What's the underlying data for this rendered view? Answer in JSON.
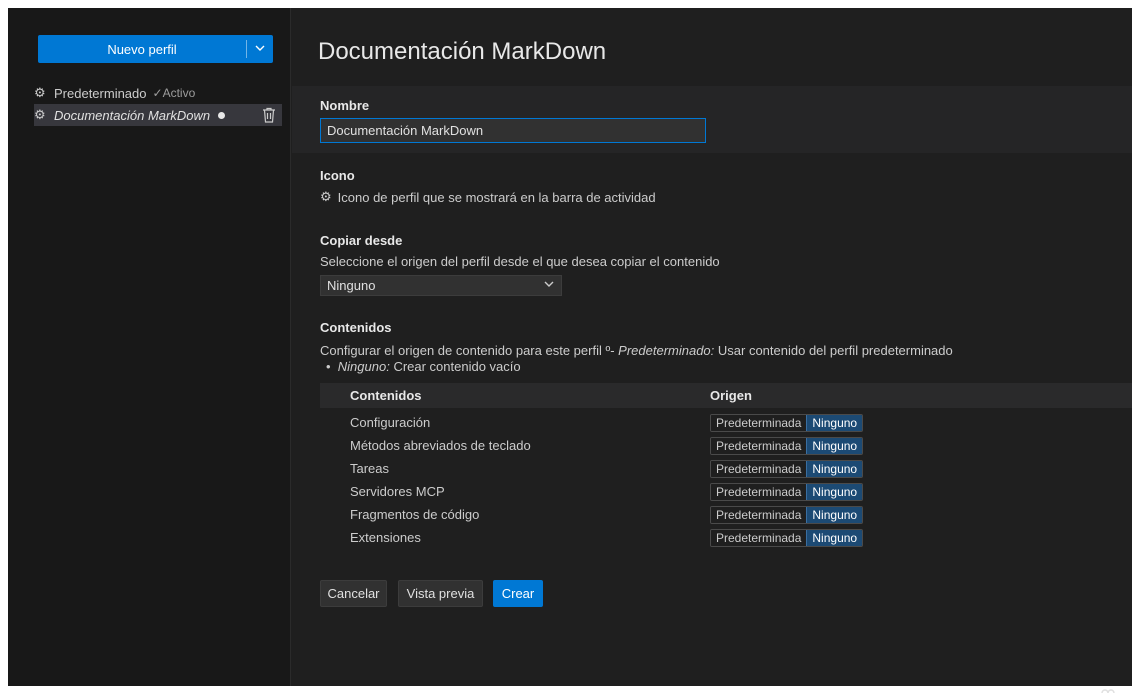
{
  "sidebar": {
    "new_profile_label": "Nuevo perfil",
    "profiles": [
      {
        "name": "Predeterminado",
        "status": "Activo"
      },
      {
        "name": "Documentación MarkDown"
      }
    ]
  },
  "main": {
    "title": "Documentación MarkDown",
    "name": {
      "label": "Nombre",
      "value": "Documentación MarkDown"
    },
    "icon": {
      "label": "Icono",
      "description": "Icono de perfil que se mostrará en la barra de actividad"
    },
    "copy_from": {
      "label": "Copiar desde",
      "description": "Seleccione el origen del perfil desde el que desea copiar el contenido",
      "selected": "Ninguno"
    },
    "contents": {
      "label": "Contenidos",
      "desc_prefix": "Configurar el origen de contenido para este perfil º- ",
      "desc_default_term": "Predeterminado:",
      "desc_default_text": " Usar contenido del perfil predeterminado",
      "bullet_term": "Ninguno:",
      "bullet_text": " Crear contenido vacío",
      "columns": [
        "Contenidos",
        "Origen"
      ],
      "option_default": "Predeterminada",
      "option_none": "Ninguno",
      "rows": [
        "Configuración",
        "Métodos abreviados de teclado",
        "Tareas",
        "Servidores MCP",
        "Fragmentos de código",
        "Extensiones"
      ]
    },
    "buttons": {
      "cancel": "Cancelar",
      "preview": "Vista previa",
      "create": "Crear"
    }
  },
  "colors": {
    "accent": "#0078d4",
    "background": "#1f1f1f",
    "selected_option": "#1c4a74"
  }
}
